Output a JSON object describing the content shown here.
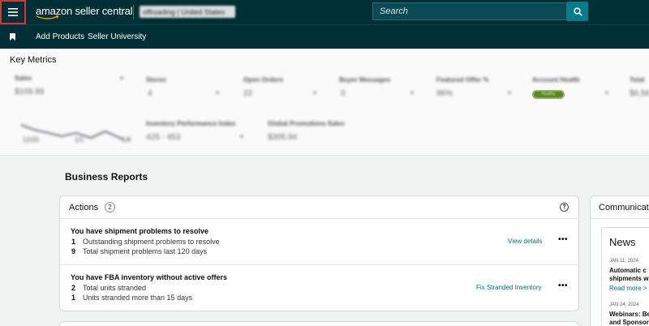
{
  "topbar": {
    "logo_text": "amazon seller central",
    "store_selector": "offroading | United States",
    "search_placeholder": "Search",
    "menu_icon": "hamburger-menu-icon",
    "search_icon": "search-icon"
  },
  "subbar": {
    "bookmark_icon": "bookmark-icon",
    "links": [
      "Add Products",
      "Seller University"
    ]
  },
  "key_metrics": {
    "title": "Key Metrics",
    "sales_label": "Sales",
    "sales_value": "$109.99",
    "chart_ticks": [
      "12/20",
      "1/1",
      "1/8"
    ],
    "items": [
      {
        "label": "Stores",
        "value": "4"
      },
      {
        "label": "Open Orders",
        "value": "22"
      },
      {
        "label": "Buyer Messages",
        "value": "0"
      },
      {
        "label": "Featured Offer %",
        "value": "96%"
      },
      {
        "label": "Account Health",
        "value": "Healthy"
      },
      {
        "label": "Total",
        "value": "$6,56"
      }
    ],
    "items_row2": [
      {
        "label": "Inventory Performance Index",
        "value": "425 - 453"
      },
      {
        "label": "Global Promotions Sales",
        "value": "$305.94"
      }
    ],
    "health_color": "#5b8a23"
  },
  "business_reports": {
    "title": "Business Reports"
  },
  "actions_card": {
    "title": "Actions",
    "count": "2",
    "help_icon": "help-circle-icon",
    "actions": [
      {
        "title": "You have shipment problems to resolve",
        "rows": [
          {
            "num": "1",
            "text": "Outstanding shipment problems to resolve"
          },
          {
            "num": "9",
            "text": "Total shipment problems last 120 days"
          }
        ],
        "link": "View details",
        "menu": "•••"
      },
      {
        "title": "You have FBA inventory without active offers",
        "rows": [
          {
            "num": "2",
            "text": "Total units stranded"
          },
          {
            "num": "1",
            "text": "Units stranded more than 15 days"
          }
        ],
        "link": "Fix Stranded Inventory",
        "menu": "•••"
      }
    ]
  },
  "communications": {
    "title": "Communications",
    "news_title": "News",
    "items": [
      {
        "date": "JAN 11, 2024",
        "headline_line1": "Automatic c",
        "headline_line2": "shipments w",
        "link": "Read more >"
      },
      {
        "date": "JAN 24, 2024",
        "headline_line1": "Webinars: Be",
        "headline_line2": "and Sponsor"
      }
    ]
  },
  "colors": {
    "topbar_bg": "#002f36",
    "search_button": "#087d8a",
    "link": "#007185",
    "highlight_border": "#e0322e"
  }
}
